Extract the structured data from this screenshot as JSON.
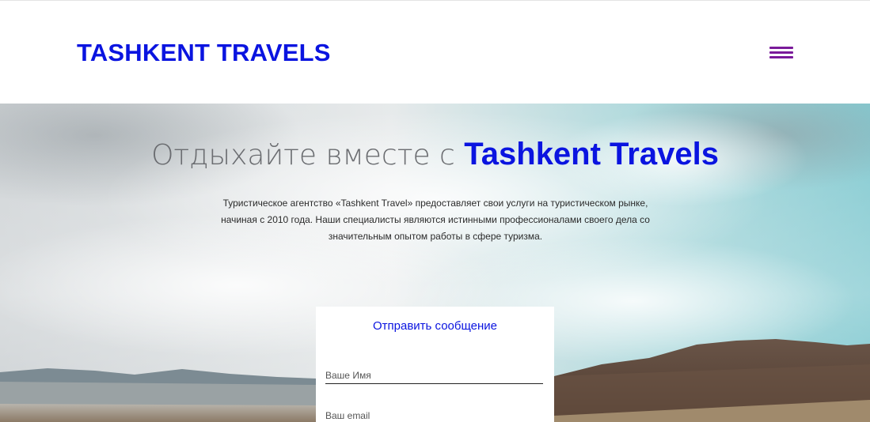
{
  "header": {
    "logo": "TASHKENT TRAVELS",
    "menu_icon": "hamburger-menu-icon"
  },
  "hero": {
    "title_prefix": "Отдыхайте вместе с ",
    "title_brand": "Tashkent Travels",
    "description": "Туристическое агентство «Tashkent Travel» предоставляет свои услуги на туристическом рынке, начиная с 2010 года. Наши специалисты являются истинными профессионалами своего дела со значительным опытом работы в сфере туризма."
  },
  "contact_form": {
    "title": "Отправить сообщение",
    "name_placeholder": "Ваше Имя",
    "email_placeholder": "Ваш email"
  },
  "colors": {
    "brand": "#0a14e0",
    "menu_icon": "#7a1a9a"
  }
}
